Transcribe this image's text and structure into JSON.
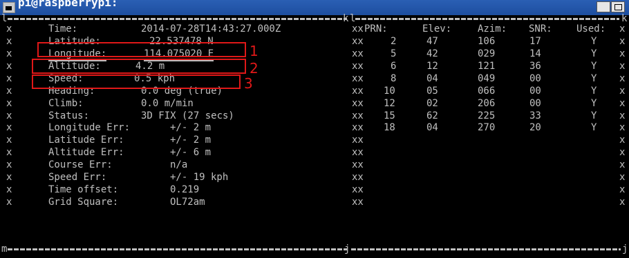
{
  "window": {
    "title": "pi@raspberrypi:"
  },
  "gps": {
    "rows": [
      {
        "label": "Time:",
        "value": "2014-07-28T14:43:27.000Z"
      },
      {
        "label": "Latitude:",
        "value": "22.537478 N"
      },
      {
        "label": "Longitude:",
        "value": "114.075020 E"
      },
      {
        "label": "Altitude:",
        "value": "4.2 m"
      },
      {
        "label": "Speed:",
        "value": "0.5 kph"
      },
      {
        "label": "Heading:",
        "value": "0.0 deg (true)"
      },
      {
        "label": "Climb:",
        "value": "0.0 m/min"
      },
      {
        "label": "Status:",
        "value": "3D FIX (27 secs)"
      },
      {
        "label": "Longitude Err:",
        "value": "+/- 2 m"
      },
      {
        "label": "Latitude Err:",
        "value": "+/- 2 m"
      },
      {
        "label": "Altitude Err:",
        "value": "+/- 6 m"
      },
      {
        "label": "Course Err:",
        "value": "n/a"
      },
      {
        "label": "Speed Err:",
        "value": "+/- 19 kph"
      },
      {
        "label": "Time offset:",
        "value": "0.219"
      },
      {
        "label": "Grid Square:",
        "value": "OL72am"
      }
    ]
  },
  "satellites": {
    "headers": {
      "prn": "PRN:",
      "elev": "Elev:",
      "azim": "Azim:",
      "snr": "SNR:",
      "used": "Used:"
    },
    "rows": [
      {
        "prn": "2",
        "elev": "47",
        "azim": "106",
        "snr": "17",
        "used": "Y"
      },
      {
        "prn": "5",
        "elev": "42",
        "azim": "029",
        "snr": "14",
        "used": "Y"
      },
      {
        "prn": "6",
        "elev": "12",
        "azim": "121",
        "snr": "36",
        "used": "Y"
      },
      {
        "prn": "8",
        "elev": "04",
        "azim": "049",
        "snr": "00",
        "used": "Y"
      },
      {
        "prn": "10",
        "elev": "05",
        "azim": "066",
        "snr": "00",
        "used": "Y"
      },
      {
        "prn": "12",
        "elev": "02",
        "azim": "206",
        "snr": "00",
        "used": "Y"
      },
      {
        "prn": "15",
        "elev": "62",
        "azim": "225",
        "snr": "33",
        "used": "Y"
      },
      {
        "prn": "18",
        "elev": "04",
        "azim": "270",
        "snr": "20",
        "used": "Y"
      }
    ]
  },
  "border": {
    "top_left": "l",
    "top_right": "k",
    "bottom_left": "m",
    "bottom_right": "j",
    "side": "x",
    "left_pane_top_right": "k",
    "right_pane_top_left": "l",
    "left_pane_side": "xx"
  },
  "annotations": {
    "label_1": "1",
    "label_2": "2",
    "label_3": "3",
    "box_color": "#e01818"
  },
  "colors": {
    "text": "#c0c0c0",
    "background": "#000000",
    "titlebar": "#1d4e9f"
  }
}
